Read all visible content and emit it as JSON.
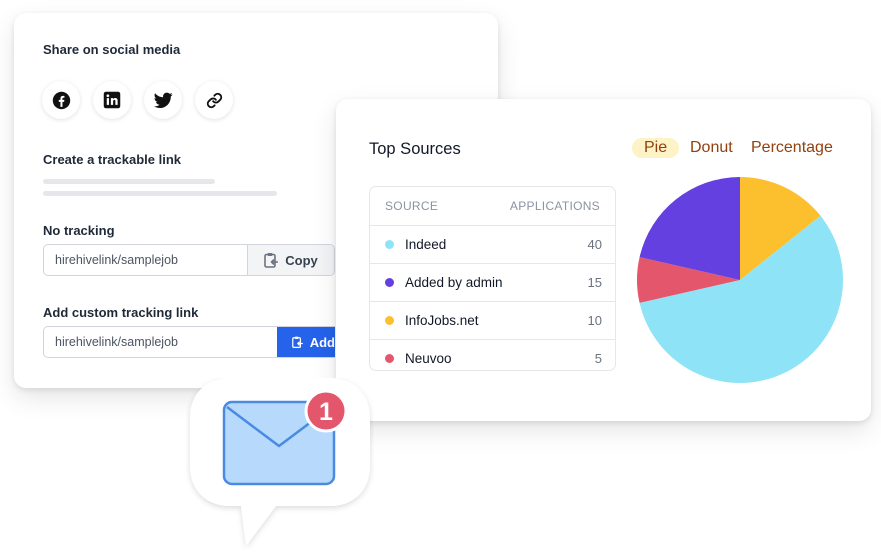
{
  "share": {
    "social_title": "Share on social media",
    "social_icons": [
      "facebook-icon",
      "linkedin-icon",
      "twitter-icon",
      "link-icon"
    ],
    "trackable_title": "Create a trackable link",
    "no_tracking": {
      "label": "No tracking",
      "value": "hirehivelink/samplejob",
      "button_label": "Copy"
    },
    "custom": {
      "label": "Add custom tracking link",
      "value": "hirehivelink/samplejob",
      "button_label": "Add"
    }
  },
  "sources": {
    "title": "Top Sources",
    "tabs": [
      "Pie",
      "Donut",
      "Percentage"
    ],
    "active_tab": "Pie",
    "headers": {
      "source": "SOURCE",
      "applications": "APPLICATIONS"
    },
    "rows": [
      {
        "name": "Indeed",
        "value": "40",
        "color": "#8fe3f7"
      },
      {
        "name": "Added by admin",
        "value": "15",
        "color": "#6440e0"
      },
      {
        "name": "InfoJobs.net",
        "value": "10",
        "color": "#fcc02e"
      },
      {
        "name": "Neuvoo",
        "value": "5",
        "color": "#e4566c"
      }
    ]
  },
  "chart_data": {
    "type": "pie",
    "labels": [
      "InfoJobs.net",
      "Indeed",
      "Neuvoo",
      "Added by admin"
    ],
    "values": [
      10,
      40,
      5,
      15
    ],
    "colors": [
      "#fcc02e",
      "#8fe3f7",
      "#e4566c",
      "#6440e0"
    ]
  },
  "notification": {
    "icon": "envelope-icon",
    "count": "1"
  },
  "colors": {
    "primary": "#2563eb",
    "badge": "#e4566c",
    "tab_text": "#92400e"
  }
}
